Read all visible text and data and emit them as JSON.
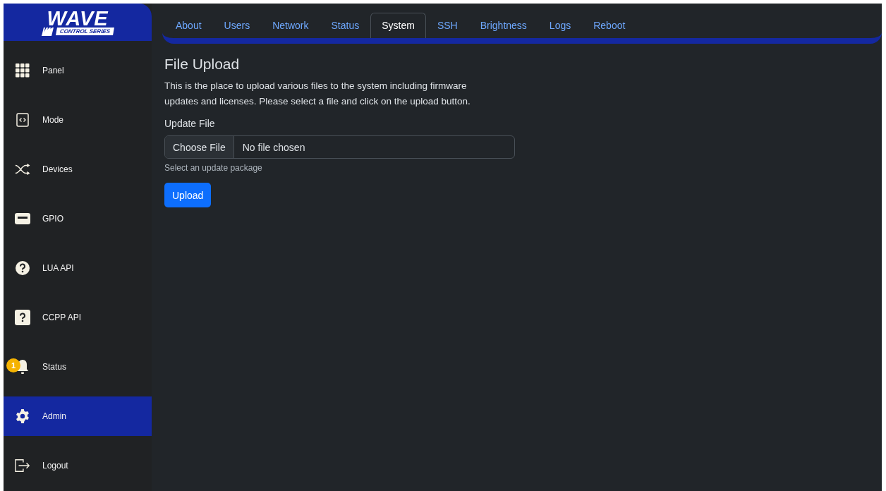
{
  "logo": {
    "title": "WAVE",
    "subtitle": "CONTROL SERIES"
  },
  "sidebar": {
    "items": [
      {
        "label": "Panel",
        "kind": "grid",
        "selected": false
      },
      {
        "label": "Mode",
        "kind": "code",
        "selected": false
      },
      {
        "label": "Devices",
        "kind": "shuffle",
        "selected": false
      },
      {
        "label": "GPIO",
        "kind": "port",
        "selected": false
      },
      {
        "label": "LUA API",
        "kind": "help-circle",
        "selected": false
      },
      {
        "label": "CCPP API",
        "kind": "help-square",
        "selected": false
      },
      {
        "label": "Status",
        "kind": "bell",
        "selected": false,
        "badge": "1"
      },
      {
        "label": "Admin",
        "kind": "gear",
        "selected": true
      },
      {
        "label": "Logout",
        "kind": "logout",
        "selected": false
      }
    ]
  },
  "tabs": [
    {
      "label": "About",
      "selected": false
    },
    {
      "label": "Users",
      "selected": false
    },
    {
      "label": "Network",
      "selected": false
    },
    {
      "label": "Status",
      "selected": false
    },
    {
      "label": "System",
      "selected": true
    },
    {
      "label": "SSH",
      "selected": false
    },
    {
      "label": "Brightness",
      "selected": false
    },
    {
      "label": "Logs",
      "selected": false
    },
    {
      "label": "Reboot",
      "selected": false
    }
  ],
  "content": {
    "title": "File Upload",
    "description": "This is the place to upload various files to the system including firmware updates and licenses. Please select a file and click on the upload button.",
    "field_label": "Update File",
    "choose_button": "Choose File",
    "file_value": "No file chosen",
    "help_text": "Select an update package",
    "upload_button": "Upload"
  }
}
